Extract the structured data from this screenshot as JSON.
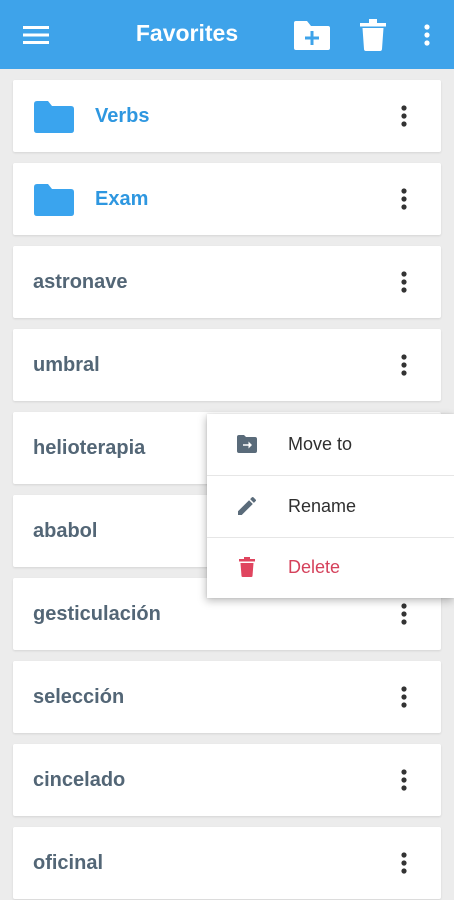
{
  "appbar": {
    "title": "Favorites",
    "menu_icon": "hamburger-menu-icon",
    "new_folder_icon": "create-new-folder-icon",
    "delete_icon": "trash-icon",
    "more_icon": "more-vertical-icon",
    "background": "#3ea3ea"
  },
  "items": [
    {
      "label": "Verbs",
      "type": "folder"
    },
    {
      "label": "Exam",
      "type": "folder"
    },
    {
      "label": "astronave",
      "type": "word"
    },
    {
      "label": "umbral",
      "type": "word"
    },
    {
      "label": "helioterapia",
      "type": "word"
    },
    {
      "label": "ababol",
      "type": "word"
    },
    {
      "label": "gesticulación",
      "type": "word"
    },
    {
      "label": "selección",
      "type": "word"
    },
    {
      "label": "cincelado",
      "type": "word"
    },
    {
      "label": "oficinal",
      "type": "word"
    }
  ],
  "context_menu": {
    "items": [
      {
        "label": "Move to",
        "icon": "move-to-icon"
      },
      {
        "label": "Rename",
        "icon": "pencil-icon"
      },
      {
        "label": "Delete",
        "icon": "trash-icon",
        "color": "#d5415b"
      }
    ]
  },
  "colors": {
    "accent": "#3ea3ea",
    "folder_text": "#2e97e0",
    "word_text": "#536676",
    "danger": "#d5415b"
  }
}
